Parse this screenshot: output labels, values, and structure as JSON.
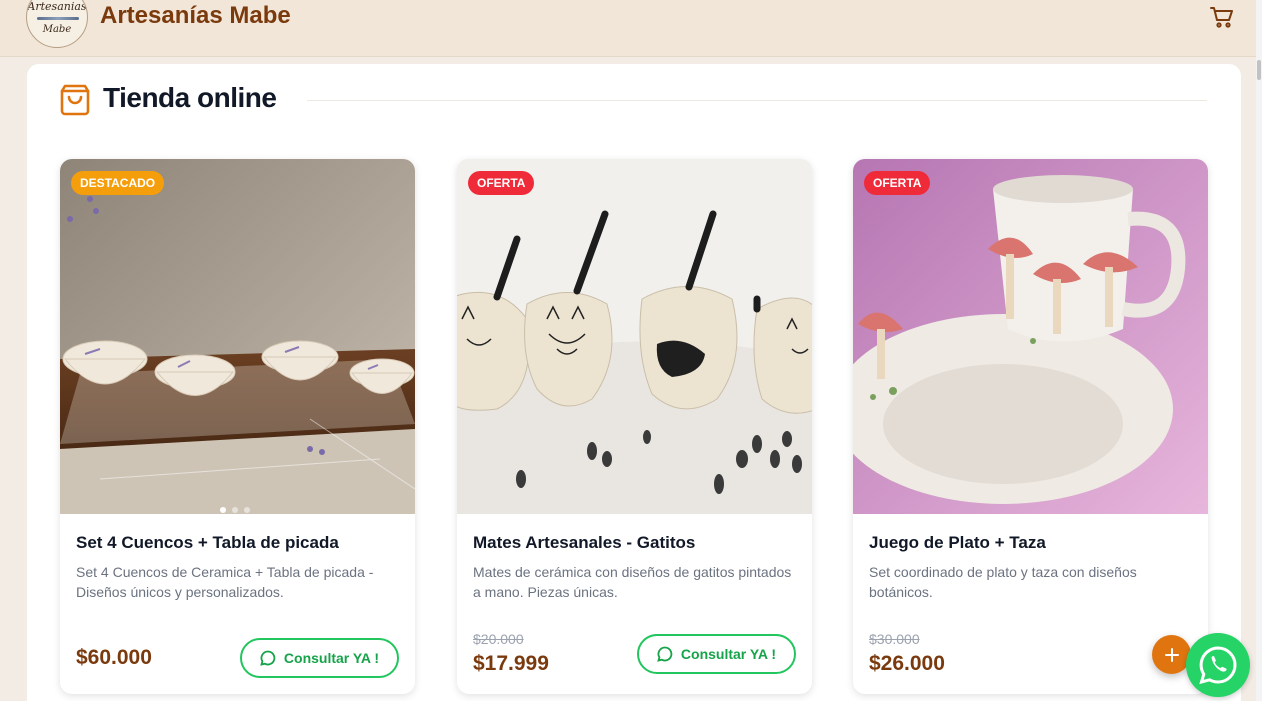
{
  "header": {
    "logo_line1": "Artesanias",
    "logo_line2": "Mabe",
    "brand": "Artesanías Mabe",
    "cart_icon": "cart-icon"
  },
  "section": {
    "title": "Tienda online",
    "icon": "shopping-bag-icon"
  },
  "products": [
    {
      "badge": "DESTACADO",
      "title": "Set 4 Cuencos + Tabla de picada",
      "description": "Set 4 Cuencos de Ceramica + Tabla de picada - Diseños únicos y personalizados.",
      "old_price": "",
      "price": "$60.000",
      "button": "Consultar YA !",
      "carousel_dots": 3
    },
    {
      "badge": "OFERTA",
      "title": "Mates Artesanales - Gatitos",
      "description": "Mates de cerámica con diseños de gatitos pintados a mano. Piezas únicas.",
      "old_price": "$20.000",
      "price": "$17.999",
      "button": "Consultar YA !"
    },
    {
      "badge": "OFERTA",
      "title": "Juego de Plato + Taza",
      "description": "Set coordinado de plato y taza con diseños botánicos.",
      "old_price": "$30.000",
      "price": "$26.000"
    }
  ],
  "floating": {
    "plus_icon": "plus-icon",
    "whatsapp_icon": "whatsapp-icon"
  },
  "colors": {
    "brand": "#7a3a0e",
    "accent": "#e07510",
    "badge_featured": "#f59e0b",
    "badge_sale": "#ef2b3a",
    "whatsapp": "#25d366"
  }
}
